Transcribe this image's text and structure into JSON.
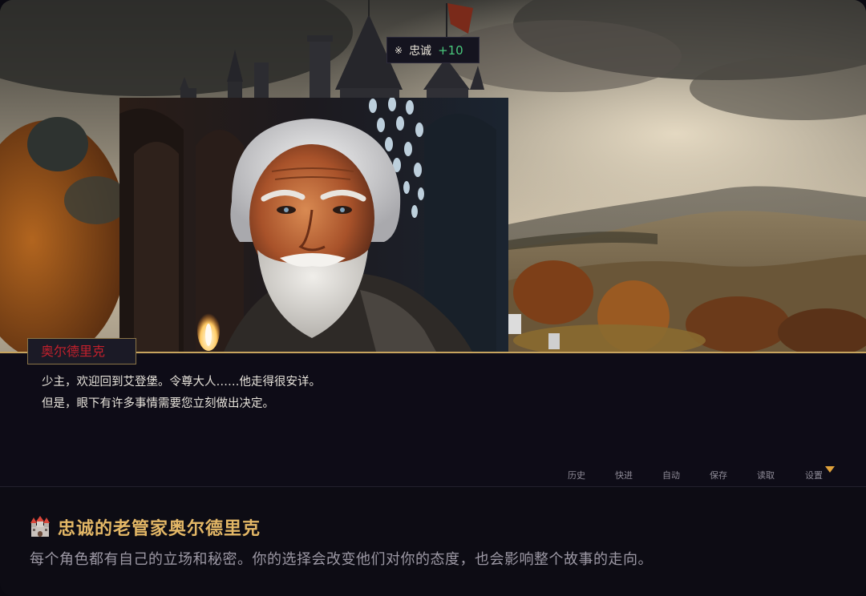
{
  "toast": {
    "mark": "※",
    "stat_name": "忠诚",
    "delta": "+10"
  },
  "dialogue": {
    "speaker": "奥尔德里克",
    "lines": [
      "少主，欢迎回到艾登堡。令尊大人……他走得很安详。",
      "但是，眼下有许多事情需要您立刻做出决定。"
    ]
  },
  "controls": {
    "history": "历史",
    "skip": "快进",
    "auto": "自动",
    "save": "保存",
    "load": "读取",
    "settings": "设置"
  },
  "caption": {
    "icon": "castle-icon",
    "title": "忠诚的老管家奥尔德里克",
    "description": "每个角色都有自己的立场和秘密。你的选择会改变他们对你的态度，也会影响整个故事的走向。"
  },
  "colors": {
    "accent_gold": "#c7a45e",
    "speaker_red": "#c2202c",
    "positive_green": "#49c77c",
    "title_gold": "#e3b766",
    "arrow_orange": "#e0a23b"
  }
}
